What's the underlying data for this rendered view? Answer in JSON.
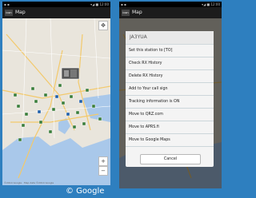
{
  "left_phone": {
    "statusbar_text": "▪ ▪",
    "statusbar_right": "▾◢ ■ 12:00",
    "app_logo": "icon",
    "title": "Map",
    "zoom_in": "+",
    "zoom_out": "−",
    "attribution": "©2014 Google · Map data ©2014 Google"
  },
  "right_phone": {
    "statusbar_text": "▪ ▪",
    "statusbar_right": "▾◢ ■ 12:00",
    "app_logo": "icon",
    "title": "Map",
    "dialog": {
      "title": "JA3YUA",
      "items": [
        "Set this station to [TO]",
        "Check RX History",
        "Delete RX History",
        "Add to Your call sign",
        "Tracking information is ON",
        "Move to QRZ.com",
        "Move to APRS.fi",
        "Move to Google Maps"
      ],
      "cancel_label": "Cancel"
    }
  },
  "footer_label": "© Google",
  "colors": {
    "background": "#2e7fbf",
    "water": "#a9c8ea",
    "land": "#e9e5dc"
  }
}
